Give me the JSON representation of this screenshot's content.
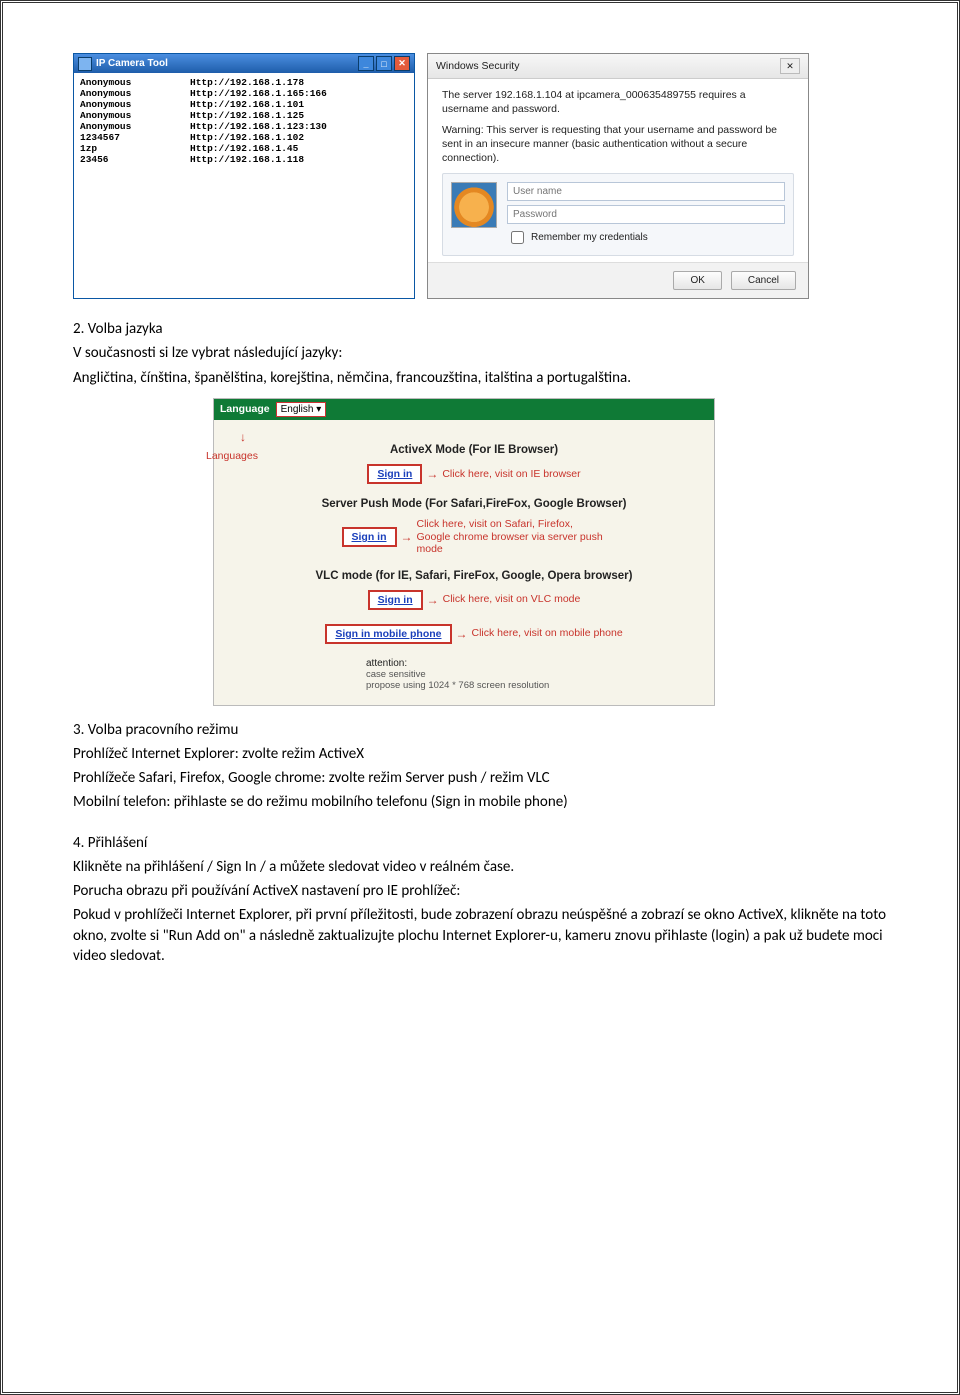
{
  "ipcam": {
    "title": "IP Camera Tool",
    "rows": [
      {
        "name": "Anonymous",
        "url": "Http://192.168.1.178"
      },
      {
        "name": "Anonymous",
        "url": "Http://192.168.1.165:166"
      },
      {
        "name": "Anonymous",
        "url": "Http://192.168.1.101"
      },
      {
        "name": "Anonymous",
        "url": "Http://192.168.1.125"
      },
      {
        "name": "Anonymous",
        "url": "Http://192.168.1.123:130"
      },
      {
        "name": "1234567",
        "url": "Http://192.168.1.102"
      },
      {
        "name": "1zp",
        "url": "Http://192.168.1.45"
      },
      {
        "name": "23456",
        "url": "Http://192.168.1.118"
      }
    ]
  },
  "winsec": {
    "title": "Windows Security",
    "line1": "The server 192.168.1.104 at ipcamera_000635489755 requires a username and password.",
    "line2": "Warning: This server is requesting that your username and password be sent in an insecure manner (basic authentication without a secure connection).",
    "username_ph": "User name",
    "password_ph": "Password",
    "remember": "Remember my credentials",
    "ok": "OK",
    "cancel": "Cancel"
  },
  "section2": {
    "heading": "2. Volba jazyka",
    "text": "V současnosti si lze vybrat následující jazyky:",
    "langs": "Angličtina, čínština, španělština, korejština, němčina, francouzština, italština a portugalština."
  },
  "lang_panel": {
    "bar_label": "Language",
    "select_value": "English",
    "languages_label": "Languages",
    "mode1": {
      "title": "ActiveX Mode (For IE Browser)",
      "button": "Sign in",
      "note": "Click here, visit on IE browser"
    },
    "mode2": {
      "title": "Server Push Mode (For Safari,FireFox, Google Browser)",
      "button": "Sign in",
      "note": "Click here, visit on Safari, Firefox, Google chrome browser via server push mode"
    },
    "mode3": {
      "title": "VLC mode (for IE, Safari, FireFox, Google, Opera browser)",
      "button": "Sign in",
      "note": "Click here, visit on VLC mode"
    },
    "mode4": {
      "button": "Sign in mobile phone",
      "note": "Click here, visit on mobile phone"
    },
    "attention_label": "attention:",
    "attention_line1": "case sensitive",
    "attention_line2": "propose using 1024 * 768 screen resolution"
  },
  "section3": {
    "heading": "3. Volba pracovního režimu",
    "line1": "Prohlížeč Internet Explorer: zvolte režim ActiveX",
    "line2": "Prohlížeče Safari, Firefox, Google chrome: zvolte režim Server push / režim VLC",
    "line3": "Mobilní telefon: přihlaste se do režimu mobilního telefonu (Sign in mobile phone)"
  },
  "section4": {
    "heading": "4. Přihlášení",
    "line1": "Klikněte na přihlášení / Sign In / a můžete sledovat video v reálném čase.",
    "line2": "Porucha obrazu při používání ActiveX nastavení pro IE prohlížeč:",
    "line3": "Pokud v prohlížeči Internet Explorer, při první příležitosti, bude zobrazení obrazu neúspěšné a zobrazí se okno ActiveX, klikněte na toto okno, zvolte si \"Run Add on\" a následně zaktualizujte plochu Internet Explorer-u, kameru znovu přihlaste (login) a pak už budete moci video sledovat."
  }
}
